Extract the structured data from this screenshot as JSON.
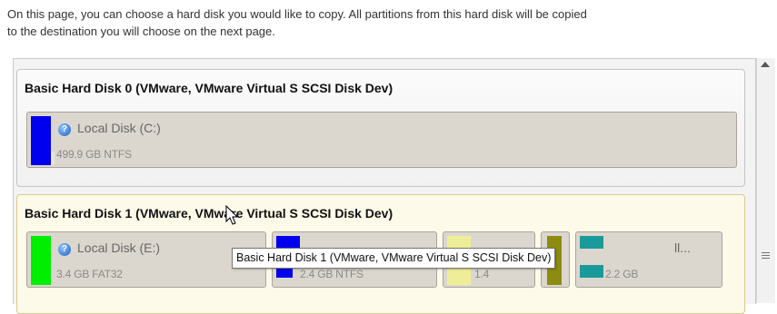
{
  "intro": {
    "line1": "On this page, you can choose a hard disk you would like to copy. All partitions from this hard disk will be copied",
    "line2": "to the destination you will choose on the next page."
  },
  "disks": [
    {
      "title": "Basic Hard Disk 0 (VMware, VMware Virtual S SCSI Disk Dev)",
      "partitions": [
        {
          "label": "Local Disk (C:)",
          "size": "499.9 GB NTFS",
          "color": "#0000ee",
          "icon": "help-icon"
        }
      ]
    },
    {
      "title": "Basic Hard Disk 1 (VMware, VMware Virtual S SCSI Disk Dev)",
      "partitions": [
        {
          "label": "Local Disk (E:)",
          "size": "3.4 GB FAT32",
          "color": "#00ee00",
          "icon": "help-icon"
        },
        {
          "label": "",
          "size": "2.4 GB NTFS",
          "color": "#0000ee"
        },
        {
          "label": "",
          "size": "1.4",
          "color": "#eeee99"
        },
        {
          "label": "",
          "size": "",
          "color": "#8c8c10"
        },
        {
          "label": "ll...",
          "size": "2.2 GB",
          "color": "#1a9a9a"
        }
      ]
    }
  ],
  "tooltip": "Basic Hard Disk 1 (VMware, VMware Virtual S SCSI Disk Dev)",
  "cursor": "arrow-cursor-icon"
}
